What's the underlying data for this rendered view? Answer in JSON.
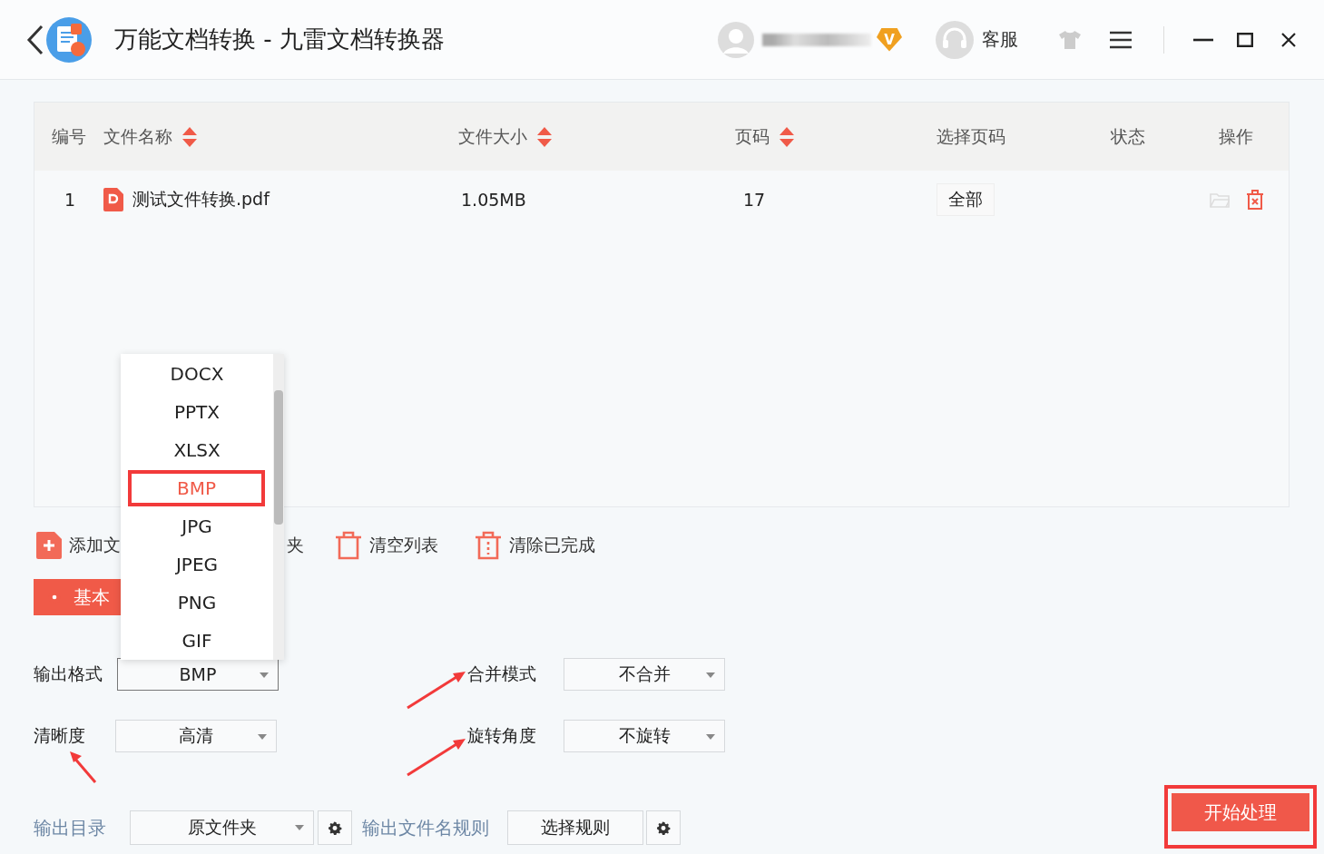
{
  "window": {
    "title": "万能文档转换 - 九雷文档转换器",
    "vip_badge": "V",
    "support": "客服"
  },
  "table": {
    "columns": [
      {
        "label": "编号",
        "sortable": false
      },
      {
        "label": "文件名称",
        "sortable": true
      },
      {
        "label": "文件大小",
        "sortable": true
      },
      {
        "label": "页码",
        "sortable": true
      },
      {
        "label": "选择页码",
        "sortable": false
      },
      {
        "label": "状态",
        "sortable": false
      },
      {
        "label": "操作",
        "sortable": false
      }
    ],
    "rows": [
      {
        "number": "1",
        "file_name": "测试文件转换.pdf",
        "size": "1.05MB",
        "pages": "17",
        "page_selection": "全部"
      }
    ]
  },
  "toolbar": [
    {
      "kind": "add",
      "label": "添加文"
    },
    {
      "kind": "plain",
      "label": "夹"
    },
    {
      "kind": "clear",
      "label": "清空列表"
    },
    {
      "kind": "clear-done",
      "label": "清除已完成"
    }
  ],
  "settings_tab": {
    "label": "基本"
  },
  "format_menu": {
    "items": [
      {
        "label": "DOCX",
        "selected": false
      },
      {
        "label": "PPTX",
        "selected": false
      },
      {
        "label": "XLSX",
        "selected": false
      },
      {
        "label": "BMP",
        "selected": true
      },
      {
        "label": "JPG",
        "selected": false
      },
      {
        "label": "JPEG",
        "selected": false
      },
      {
        "label": "PNG",
        "selected": false
      },
      {
        "label": "GIF",
        "selected": false
      }
    ]
  },
  "settings": [
    {
      "label": "输出格式",
      "value": "BMP",
      "focused": true,
      "arrow": false
    },
    {
      "label": "合并模式",
      "value": "不合并",
      "focused": false,
      "arrow": true
    },
    {
      "label": "清晰度",
      "value": "高清",
      "focused": false,
      "arrow": true
    },
    {
      "label": "旋转角度",
      "value": "不旋转",
      "focused": false,
      "arrow": true
    }
  ],
  "output": {
    "label": "输出目录",
    "value": "原文件夹",
    "rule_label": "输出文件名规则",
    "rule_button": "选择规则"
  },
  "start_button": {
    "label": "开始处理",
    "highlighted": true
  }
}
